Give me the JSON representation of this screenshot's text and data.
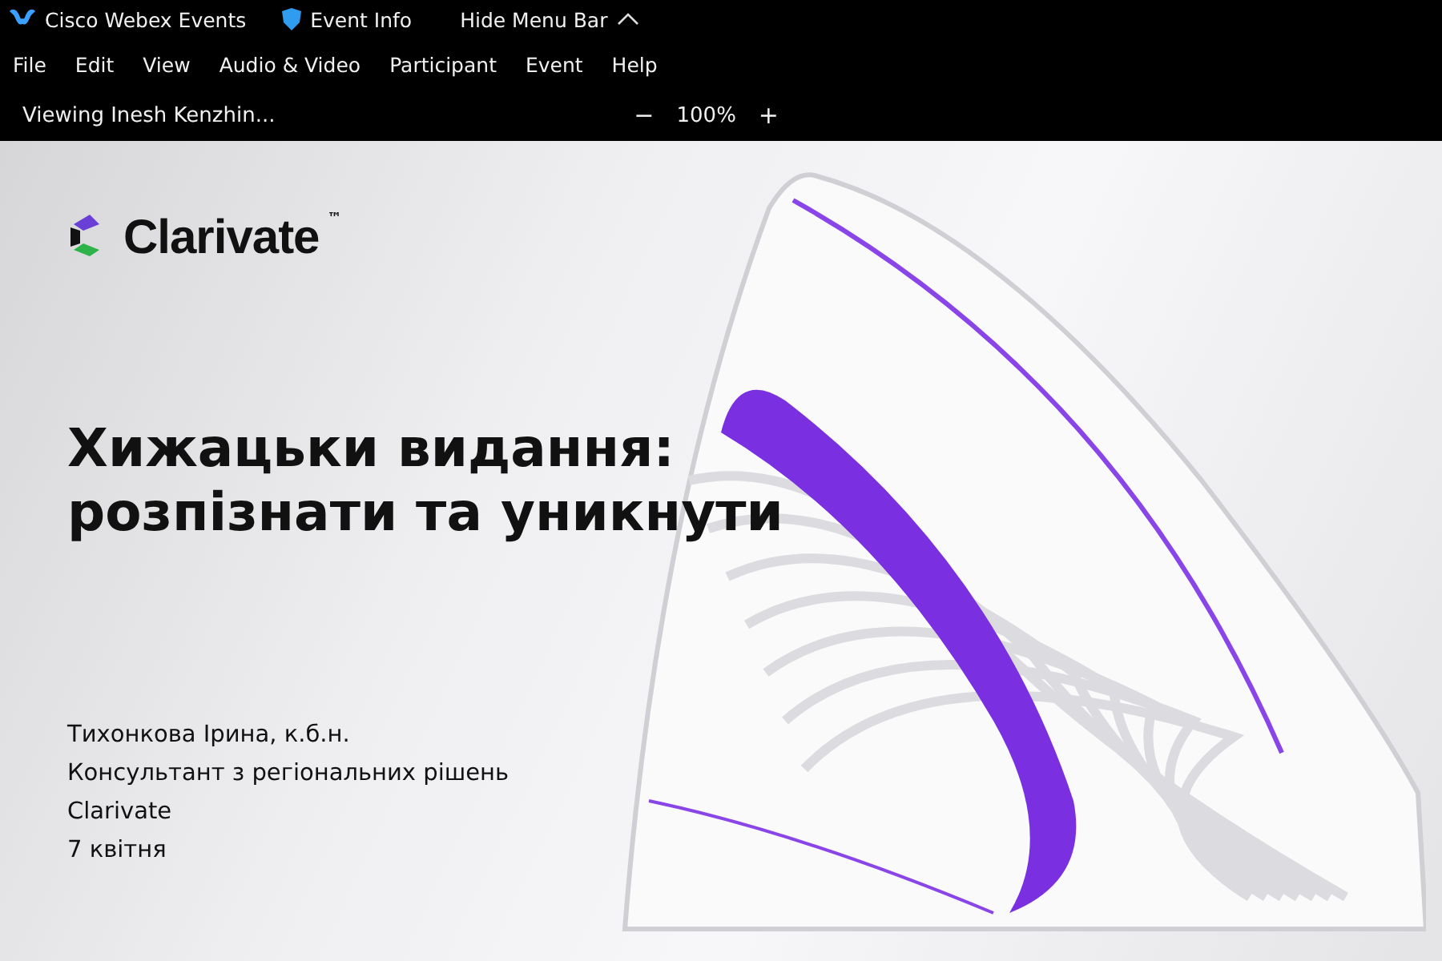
{
  "title_bar": {
    "app_name": "Cisco Webex Events",
    "event_info": "Event Info",
    "hide_menu": "Hide Menu Bar"
  },
  "menu": [
    "File",
    "Edit",
    "View",
    "Audio & Video",
    "Participant",
    "Event",
    "Help"
  ],
  "viewing_bar": {
    "status": "Viewing Inesh Kenzhin...",
    "zoom_out": "−",
    "zoom": "100%",
    "zoom_in": "+"
  },
  "slide": {
    "logo": "Clarivate",
    "trademark": "™",
    "title_lines": [
      "Хижацьки видання:",
      "розпізнати та уникнути"
    ],
    "details": [
      "Тихонкова Ірина, к.б.н.",
      "Консультант з регіональних рішень",
      "Clarivate",
      "7 квітня"
    ]
  }
}
